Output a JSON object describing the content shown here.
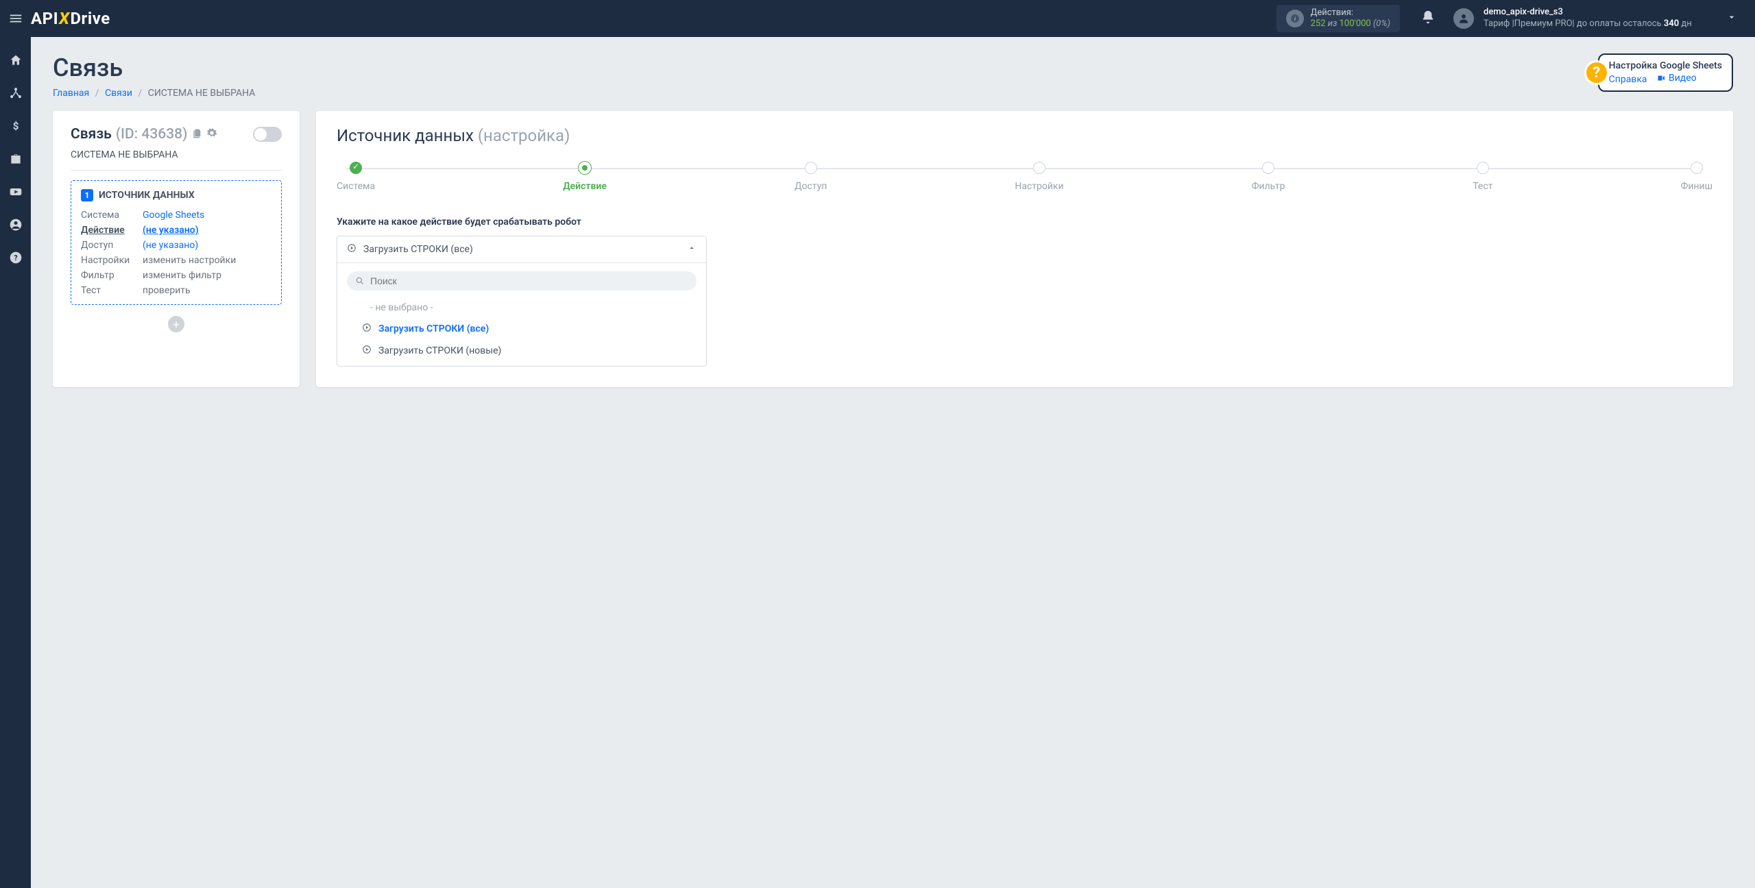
{
  "logo": {
    "a": "API",
    "x": "X",
    "d": "Drive"
  },
  "actions": {
    "label": "Действия:",
    "used": "252",
    "sep": "из",
    "total": "100'000",
    "pct": "(0%)"
  },
  "user": {
    "name": "demo_apix-drive_s3",
    "tariff_prefix": "Тариф |Премиум PRO|  до оплаты осталось ",
    "days": "340",
    "days_suffix": " дн"
  },
  "page": {
    "title": "Связь",
    "breadcrumbs": {
      "home": "Главная",
      "links": "Связи",
      "current": "СИСТЕМА НЕ ВЫБРАНА"
    }
  },
  "help": {
    "title": "Настройка Google Sheets",
    "help": "Справка",
    "video": "Видео",
    "badge": "?"
  },
  "card_left": {
    "name": "Связь",
    "id": "(ID: 43638)",
    "sub": "СИСТЕМА НЕ ВЫБРАНА",
    "box_badge": "1",
    "box_title": "ИСТОЧНИК ДАННЫХ",
    "rows": {
      "system": {
        "lbl": "Система",
        "val": "Google Sheets"
      },
      "action": {
        "lbl": "Действие",
        "val": "(не указано)"
      },
      "access": {
        "lbl": "Доступ",
        "val": "(не указано)"
      },
      "settings": {
        "lbl": "Настройки",
        "val": "изменить настройки"
      },
      "filter": {
        "lbl": "Фильтр",
        "val": "изменить фильтр"
      },
      "test": {
        "lbl": "Тест",
        "val": "проверить"
      }
    },
    "add": "+"
  },
  "card_right": {
    "title": "Источник данных",
    "sub": "(настройка)",
    "steps": [
      "Система",
      "Действие",
      "Доступ",
      "Настройки",
      "Фильтр",
      "Тест",
      "Финиш"
    ],
    "prompt": "Укажите на какое действие будет срабатывать робот",
    "dropdown": {
      "selected": "Загрузить СТРОКИ (все)",
      "search_placeholder": "Поиск",
      "options": {
        "none": "- не выбрано -",
        "all": "Загрузить СТРОКИ (все)",
        "new": "Загрузить СТРОКИ (новые)"
      }
    }
  }
}
